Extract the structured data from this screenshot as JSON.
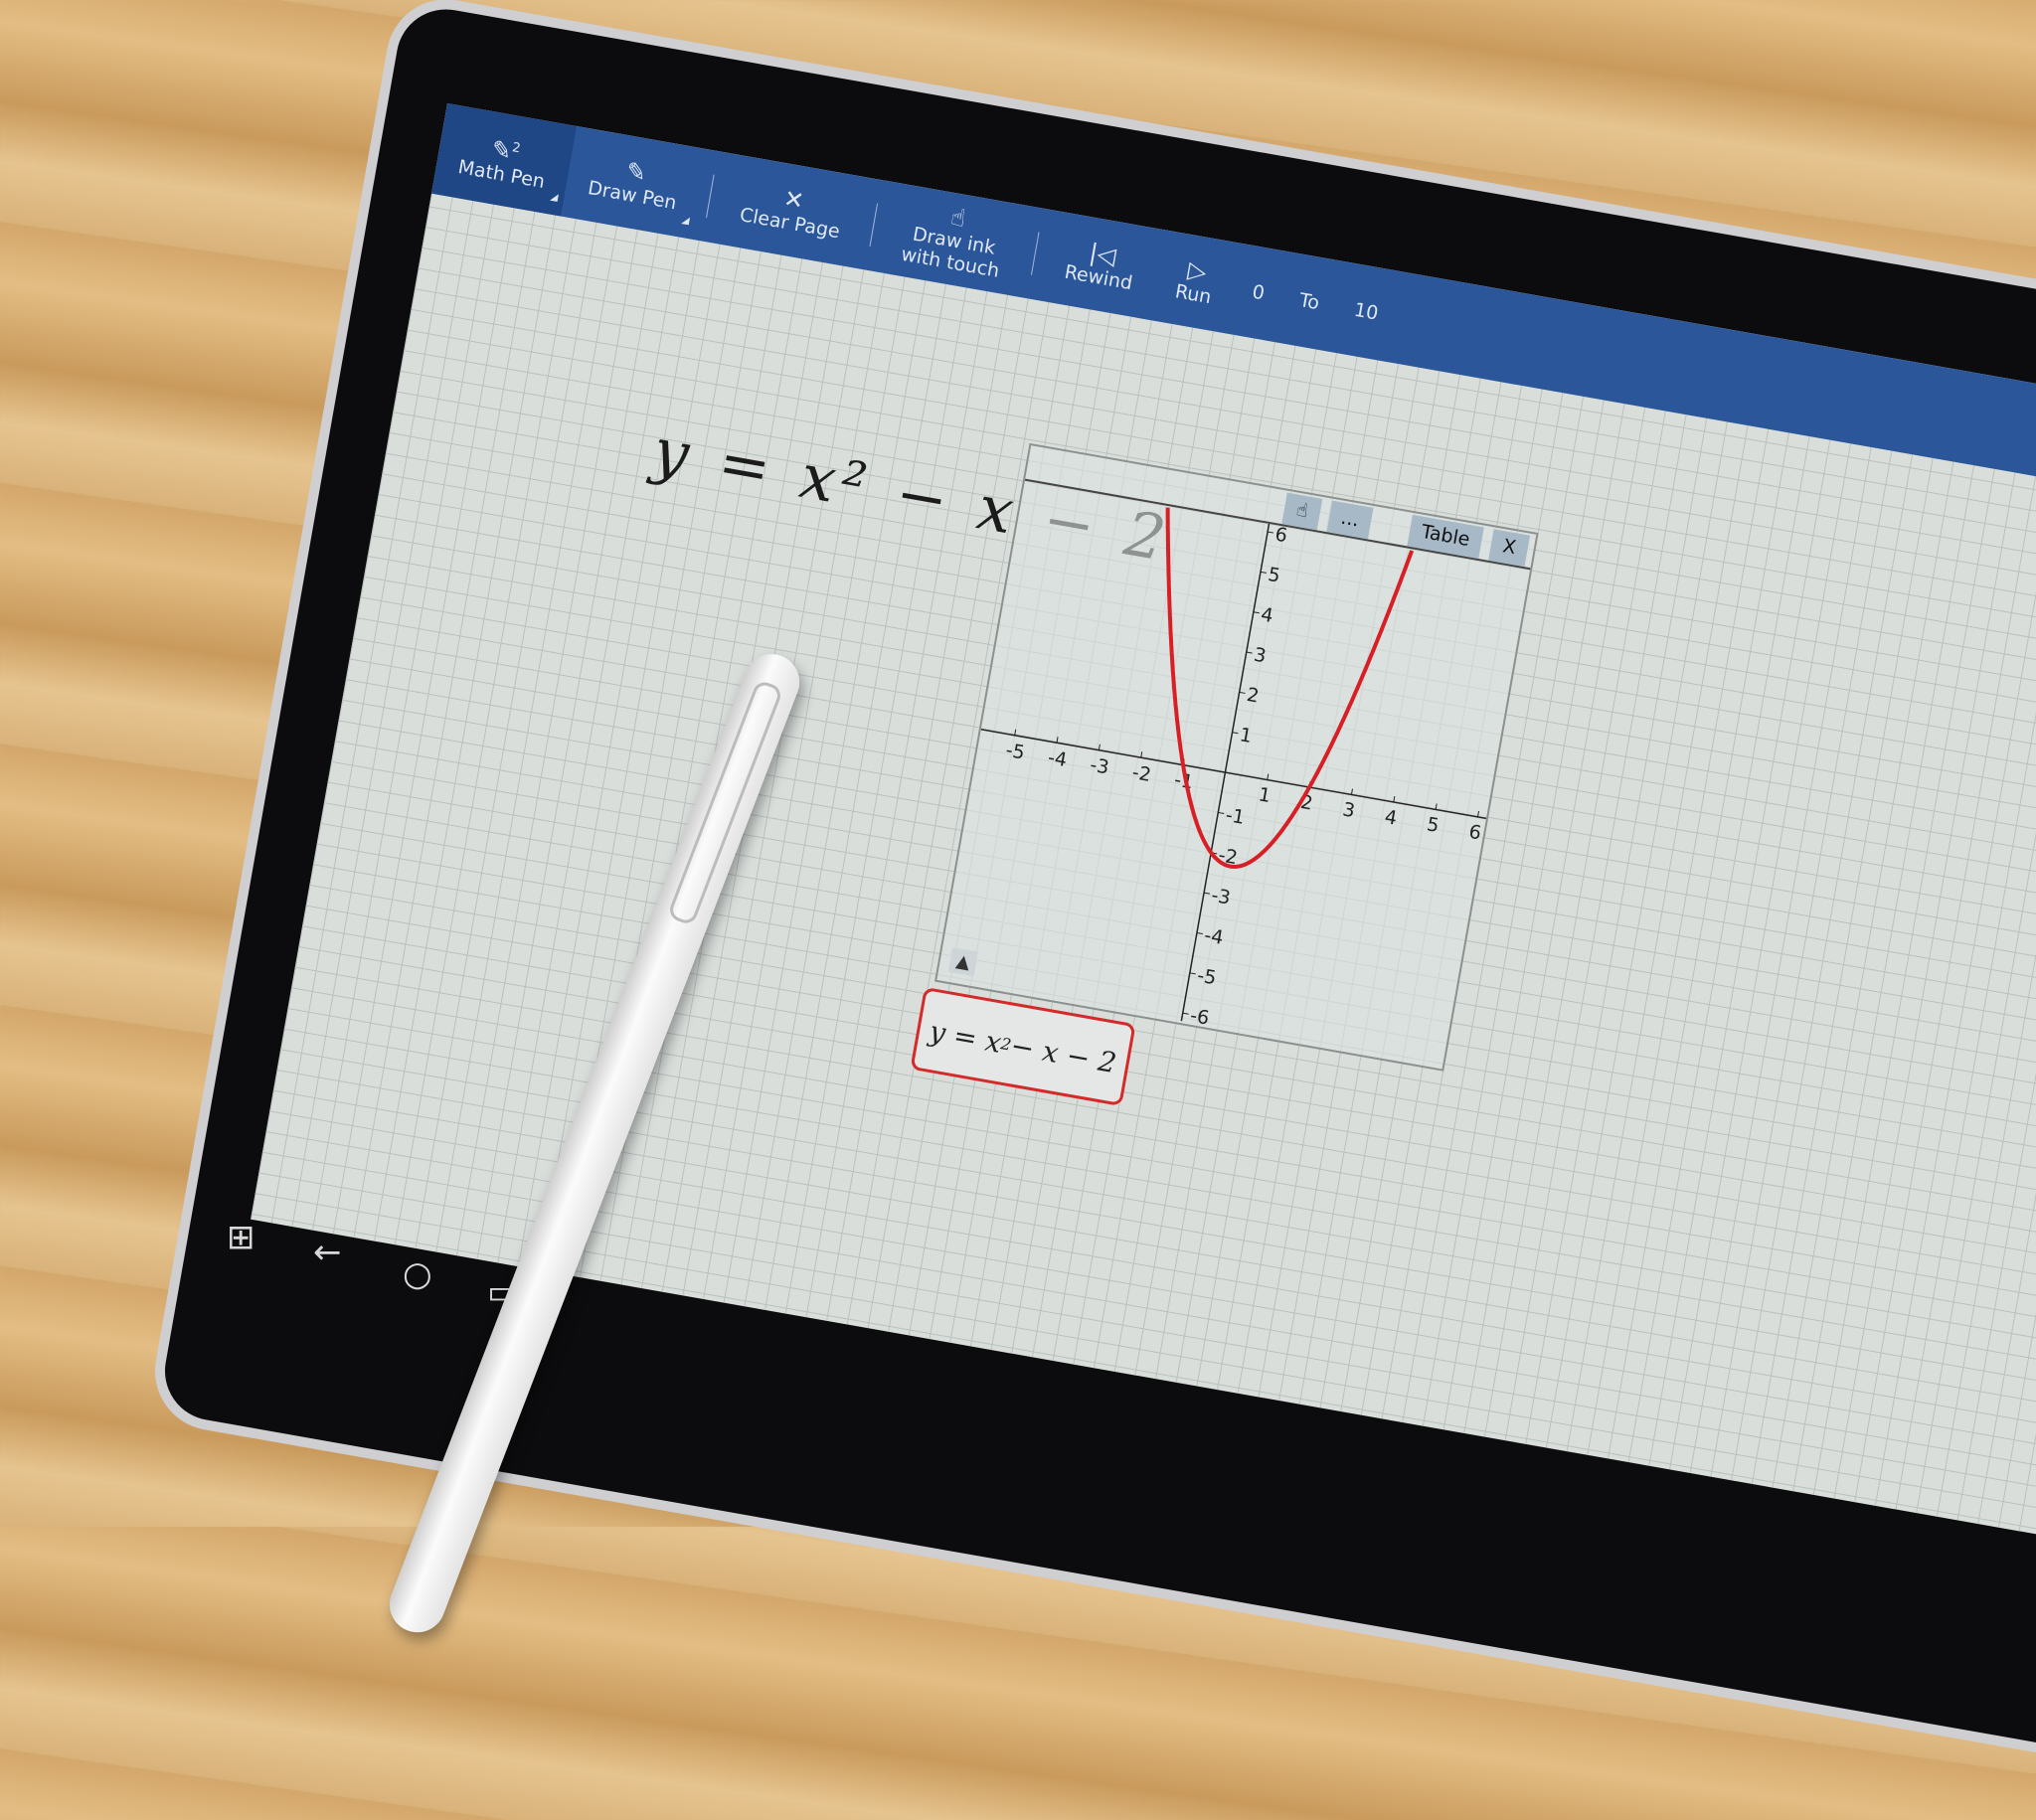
{
  "toolbar": {
    "math_pen": {
      "label": "Math Pen",
      "badge": "2"
    },
    "draw_pen": {
      "label": "Draw Pen"
    },
    "clear_page": {
      "label": "Clear Page"
    },
    "draw_ink": {
      "label1": "Draw ink",
      "label2": "with touch"
    },
    "rewind": {
      "label": "Rewind"
    },
    "run": {
      "label": "Run"
    },
    "from_value": "0",
    "to_label": "To",
    "to_value": "10"
  },
  "canvas": {
    "handwritten_equation": "y = x² − x − 2"
  },
  "graph_window": {
    "dots_label": "...",
    "table_label": "Table",
    "close_label": "X",
    "collapse_label": "▲",
    "equation": {
      "lhs": "y = x",
      "exp": "2",
      "rhs": " − x − 2"
    },
    "coefficients": {
      "a": 1,
      "b": -1,
      "c": -2
    },
    "x_range": [
      -6,
      6
    ],
    "y_range": [
      -6,
      6
    ],
    "x_ticks": [
      "-5",
      "-4",
      "-3",
      "-2",
      "-1",
      "1",
      "2",
      "3",
      "4",
      "5",
      "6"
    ],
    "y_ticks": [
      "6",
      "5",
      "4",
      "3",
      "2",
      "1",
      "-1",
      "-2",
      "-3",
      "-4",
      "-5",
      "-6"
    ],
    "curve_color": "#d81f26"
  },
  "taskbar": {
    "icons": [
      "windows-icon",
      "back-icon",
      "home-icon",
      "task-view-icon"
    ]
  }
}
